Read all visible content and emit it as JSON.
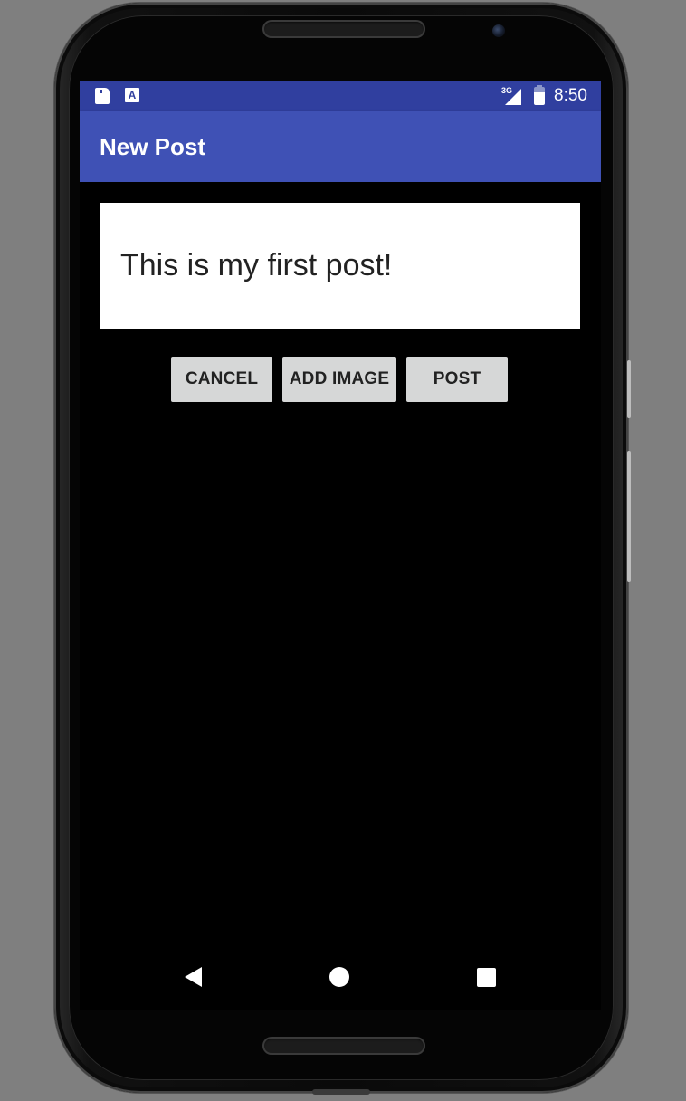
{
  "status_bar": {
    "network_type": "3G",
    "time": "8:50",
    "notification_a_glyph": "A",
    "icons": [
      "sd-card-icon",
      "app-notification-icon",
      "signal-icon",
      "battery-charging-icon"
    ]
  },
  "app_bar": {
    "title": "New Post"
  },
  "post_editor": {
    "value": "This is my first post!"
  },
  "actions": {
    "cancel_label": "CANCEL",
    "add_image_label": "ADD IMAGE",
    "post_label": "POST"
  },
  "navigation_bar": {
    "icons": [
      "back-icon",
      "home-icon",
      "recents-icon"
    ]
  },
  "colors": {
    "status_bar": "#303f9f",
    "app_bar": "#3f51b5",
    "button": "#d6d7d7",
    "screen_background": "#000000"
  }
}
